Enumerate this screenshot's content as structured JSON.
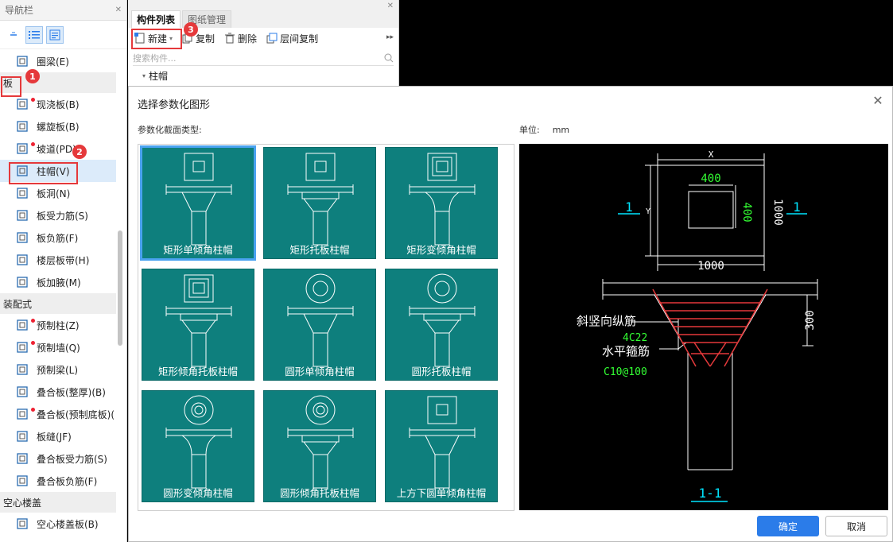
{
  "nav": {
    "title": "导航栏",
    "items_top": [
      {
        "label": "圈梁(E)",
        "icon": "ring-beam-icon"
      }
    ],
    "cat_ban": "板",
    "items_ban": [
      {
        "label": "现浇板(B)",
        "icon": "cast-slab-icon",
        "dot": true
      },
      {
        "label": "螺旋板(B)",
        "icon": "spiral-slab-icon",
        "dot": false
      },
      {
        "label": "坡道(PD)",
        "icon": "ramp-icon",
        "dot": true
      },
      {
        "label": "柱帽(V)",
        "icon": "column-cap-icon",
        "dot": false,
        "selected": true
      },
      {
        "label": "板洞(N)",
        "icon": "slab-hole-icon",
        "dot": false
      },
      {
        "label": "板受力筋(S)",
        "icon": "slab-rebar-icon",
        "dot": false
      },
      {
        "label": "板负筋(F)",
        "icon": "negative-rebar-icon",
        "dot": false
      },
      {
        "label": "楼层板带(H)",
        "icon": "slab-strip-icon",
        "dot": false
      },
      {
        "label": "板加腋(M)",
        "icon": "slab-haunch-icon",
        "dot": false
      }
    ],
    "cat_prefab": "装配式",
    "items_prefab": [
      {
        "label": "预制柱(Z)",
        "icon": "precast-column-icon",
        "dot": true
      },
      {
        "label": "预制墙(Q)",
        "icon": "precast-wall-icon",
        "dot": true
      },
      {
        "label": "预制梁(L)",
        "icon": "precast-beam-icon",
        "dot": false
      },
      {
        "label": "叠合板(整厚)(B)",
        "icon": "composite-slab-icon",
        "dot": false
      },
      {
        "label": "叠合板(预制底板)(",
        "icon": "composite-bottom-icon",
        "dot": true
      },
      {
        "label": "板缝(JF)",
        "icon": "slab-joint-icon",
        "dot": false
      },
      {
        "label": "叠合板受力筋(S)",
        "icon": "composite-rebar-icon",
        "dot": false
      },
      {
        "label": "叠合板负筋(F)",
        "icon": "composite-neg-icon",
        "dot": false
      }
    ],
    "cat_hollow": "空心楼盖",
    "items_hollow": [
      {
        "label": "空心楼盖板(B)",
        "icon": "hollow-slab-icon",
        "dot": false
      }
    ]
  },
  "badges": [
    "1",
    "2",
    "3"
  ],
  "comp": {
    "tabs": [
      "构件列表",
      "图纸管理"
    ],
    "toolbar": {
      "new": "新建",
      "copy": "复制",
      "delete": "删除",
      "floor_copy": "层间复制"
    },
    "search_placeholder": "搜索构件...",
    "tree_node": "柱帽"
  },
  "dialog": {
    "title": "选择参数化图形",
    "section_label": "参数化截面类型:",
    "unit_label": "单位:",
    "unit_value": "mm",
    "shapes": [
      "矩形单倾角柱帽",
      "矩形托板柱帽",
      "矩形变倾角柱帽",
      "矩形倾角托板柱帽",
      "圆形单倾角柱帽",
      "圆形托板柱帽",
      "圆形变倾角柱帽",
      "圆形倾角托板柱帽",
      "上方下圆单倾角柱帽"
    ],
    "ok": "确定",
    "cancel": "取消"
  },
  "preview": {
    "dim_x": "X",
    "dim_y": "Y",
    "dim_400_top": "400",
    "dim_400_side": "400",
    "dim_1000_side": "1000",
    "dim_1000_bottom": "1000",
    "sec_mark_left": "1",
    "sec_mark_right": "1",
    "dim_300": "300",
    "label_rebar": "斜竖向纵筋",
    "label_rebar_val": "4C22",
    "label_stirrup": "水平箍筋",
    "label_stirrup_val": "C10@100",
    "section_title": "1-1"
  },
  "colors": {
    "tile": "#0e7f7d",
    "accent": "#2b7ce9",
    "red": "#e5393b",
    "dim_green": "#33ff33",
    "cyan": "#00e5ff"
  }
}
